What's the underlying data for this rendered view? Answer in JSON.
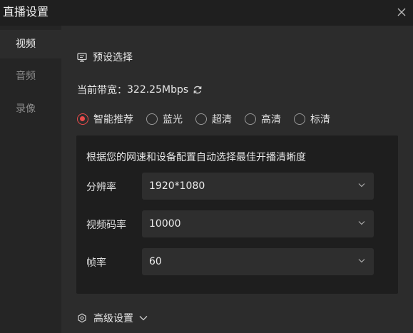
{
  "window": {
    "title": "直播设置"
  },
  "sidebar": {
    "items": [
      {
        "label": "视频",
        "active": true
      },
      {
        "label": "音频",
        "active": false
      },
      {
        "label": "录像",
        "active": false
      }
    ]
  },
  "preset": {
    "heading": "预设选择",
    "bandwidth_label": "当前带宽：",
    "bandwidth_value": "322.25Mbps",
    "options": [
      "智能推荐",
      "蓝光",
      "超清",
      "高清",
      "标清"
    ],
    "selected": "智能推荐"
  },
  "panel": {
    "description": "根据您的网速和设备配置自动选择最佳开播清晰度",
    "fields": [
      {
        "label": "分辨率",
        "value": "1920*1080"
      },
      {
        "label": "视频码率",
        "value": "10000"
      },
      {
        "label": "帧率",
        "value": "60"
      }
    ]
  },
  "advanced": {
    "label": "高级设置"
  },
  "colors": {
    "accent": "#e94b4b",
    "background": "#2c2c2c",
    "panel": "#1e1e1e",
    "sidebar": "#252525"
  }
}
